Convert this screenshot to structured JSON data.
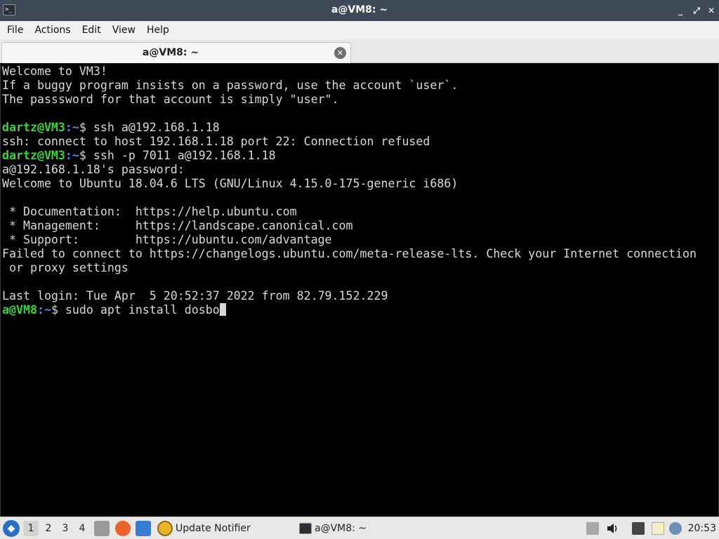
{
  "window": {
    "title": "a@VM8: ~",
    "minimize_glyph": "_",
    "maximize_glyph": "⤢",
    "close_glyph": "✕"
  },
  "menubar": {
    "items": [
      "File",
      "Actions",
      "Edit",
      "View",
      "Help"
    ]
  },
  "tabs": [
    {
      "label": "a@VM8: ~",
      "close_glyph": "✕"
    }
  ],
  "terminal": {
    "lines": [
      "Welcome to VM3!",
      "If a buggy program insists on a password, use the account `user`.",
      "The passsword for that account is simply \"user\".",
      "",
      {
        "user": "dartz@VM3",
        "path": ":~",
        "rest": "$ ssh a@192.168.1.18"
      },
      "ssh: connect to host 192.168.1.18 port 22: Connection refused",
      {
        "user": "dartz@VM3",
        "path": ":~",
        "rest": "$ ssh -p 7011 a@192.168.1.18"
      },
      "a@192.168.1.18's password:",
      "Welcome to Ubuntu 18.04.6 LTS (GNU/Linux 4.15.0-175-generic i686)",
      "",
      " * Documentation:  https://help.ubuntu.com",
      " * Management:     https://landscape.canonical.com",
      " * Support:        https://ubuntu.com/advantage",
      "Failed to connect to https://changelogs.ubuntu.com/meta-release-lts. Check your Internet connection",
      " or proxy settings",
      "",
      "Last login: Tue Apr  5 20:52:37 2022 from 82.79.152.229"
    ],
    "current_prompt": {
      "user": "a@VM8",
      "path": ":~",
      "rest": "$ sudo apt install dosbo"
    }
  },
  "taskbar": {
    "workspaces": [
      "1",
      "2",
      "3",
      "4"
    ],
    "active_workspace": "1",
    "icons": [
      "file-manager-icon",
      "firefox-icon",
      "desktop-icon"
    ],
    "update_notifier_label": "Update Notifier",
    "task_label": "a@VM8: ~",
    "clock": "20:53",
    "colors": {
      "accent": "#2a6fc4",
      "prompt_user": "#3fd23f",
      "prompt_path": "#5b86d8"
    }
  }
}
